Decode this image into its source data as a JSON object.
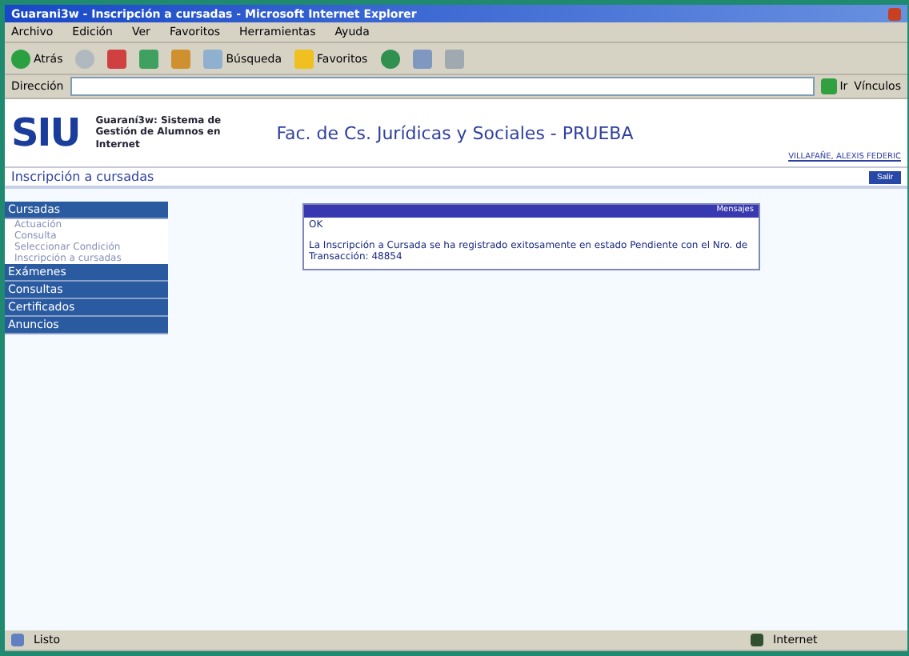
{
  "window": {
    "title": "Guarani3w - Inscripción a cursadas - Microsoft Internet Explorer"
  },
  "menu": [
    "Archivo",
    "Edición",
    "Ver",
    "Favoritos",
    "Herramientas",
    "Ayuda"
  ],
  "toolbar": {
    "back": "Atrás",
    "search": "Búsqueda",
    "favorites": "Favoritos"
  },
  "address": {
    "label": "Dirección",
    "go": "Ir",
    "links": "Vínculos"
  },
  "header": {
    "logo": "SIU",
    "system": "Guaraní3w: Sistema de Gestión de Alumnos en Internet",
    "faculty": "Fac. de Cs. Jurídicas y Sociales - PRUEBA",
    "user": "VILLAFAÑE, ALEXIS FEDERIC"
  },
  "page": {
    "title": "Inscripción a cursadas",
    "exit": "Salir"
  },
  "sidebar": {
    "items": [
      {
        "label": "Cursadas",
        "children": [
          {
            "label": "Actuación"
          },
          {
            "label": "Consulta"
          },
          {
            "label": "Seleccionar Condición"
          },
          {
            "label": "Inscripción a cursadas"
          }
        ]
      },
      {
        "label": "Exámenes"
      },
      {
        "label": "Consultas"
      },
      {
        "label": "Certificados"
      },
      {
        "label": "Anuncios"
      }
    ]
  },
  "message": {
    "title": "Mensajes",
    "ok": "OK",
    "text": "La Inscripción a Cursada se ha registrado exitosamente en estado Pendiente con el Nro. de Transacción: 48854"
  },
  "status_bar": {
    "left": "Listo",
    "zone": "Internet"
  }
}
